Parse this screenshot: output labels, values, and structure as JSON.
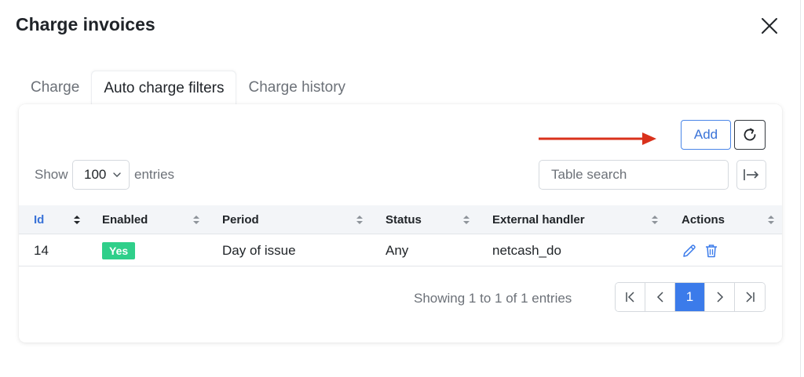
{
  "dialog": {
    "title": "Charge invoices"
  },
  "tabs": [
    {
      "label": "Charge",
      "active": false
    },
    {
      "label": "Auto charge filters",
      "active": true
    },
    {
      "label": "Charge history",
      "active": false
    }
  ],
  "toolbar": {
    "add_label": "Add",
    "refresh_icon": "refresh-icon",
    "annotation_color": "#d9311b"
  },
  "entries": {
    "show_label": "Show",
    "value": "100",
    "suffix": "entries"
  },
  "search": {
    "placeholder": "Table search"
  },
  "table": {
    "columns": [
      "Id",
      "Enabled",
      "Period",
      "Status",
      "External handler",
      "Actions"
    ],
    "sorted_column": "Id",
    "rows": [
      {
        "id": "14",
        "enabled": "Yes",
        "period": "Day of issue",
        "status": "Any",
        "handler": "netcash_do"
      }
    ]
  },
  "footer": {
    "showing_text": "Showing 1 to 1 of 1 entries",
    "current_page": "1"
  },
  "colors": {
    "accent": "#3b7bea",
    "success": "#2fcf8a"
  }
}
